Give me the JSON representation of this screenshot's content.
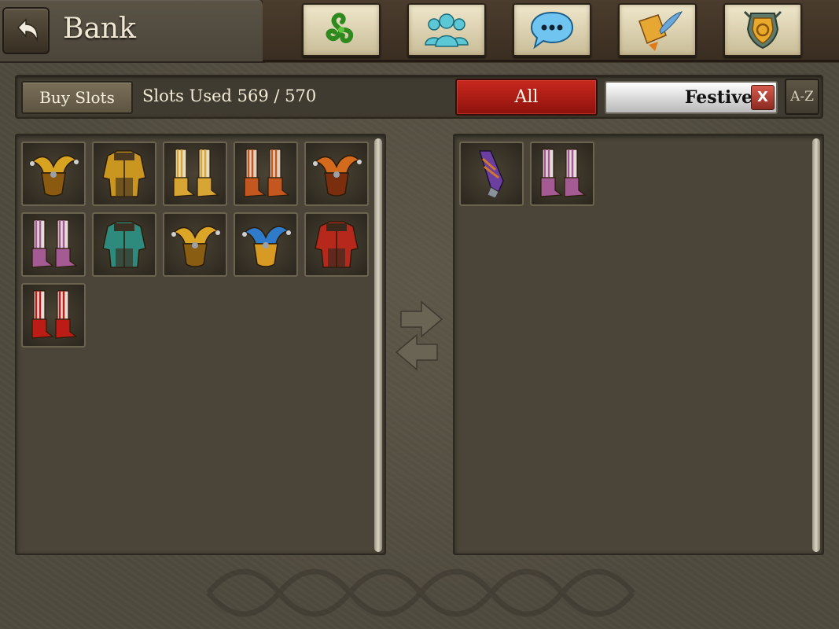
{
  "header": {
    "title": "Bank",
    "back_icon": "back-arrow-icon",
    "nav_tabs": [
      {
        "name": "triskelion-tab",
        "icon": "triskelion-icon"
      },
      {
        "name": "guild-tab",
        "icon": "people-icon"
      },
      {
        "name": "chat-tab",
        "icon": "chat-bubble-icon"
      },
      {
        "name": "quests-tab",
        "icon": "scroll-quill-icon"
      },
      {
        "name": "crest-tab",
        "icon": "shield-crest-icon"
      }
    ]
  },
  "toolbar": {
    "buy_slots_label": "Buy Slots",
    "slots_used_text": "Slots Used 569 / 570",
    "all_label": "All",
    "filter_value": "Festive",
    "clear_label": "X",
    "sort_label": "A-Z"
  },
  "bank_items": [
    {
      "name": "jester-hat-yellow",
      "colors": [
        "#d9a322",
        "#8a5a10"
      ]
    },
    {
      "name": "jester-tunic-yellow",
      "colors": [
        "#c9961f",
        "#4a3820"
      ]
    },
    {
      "name": "jester-boots-yellow",
      "colors": [
        "#d7a534",
        "#e8dcc0"
      ]
    },
    {
      "name": "jester-boots-orange",
      "colors": [
        "#c4561f",
        "#e0d0c0"
      ]
    },
    {
      "name": "jester-hat-orange",
      "colors": [
        "#d46a1c",
        "#7a2e0e"
      ]
    },
    {
      "name": "jester-boots-pink",
      "colors": [
        "#a45a92",
        "#e6dcdc"
      ]
    },
    {
      "name": "jester-tunic-teal",
      "colors": [
        "#2f8a7e",
        "#3a3124"
      ]
    },
    {
      "name": "jester-hat-gold",
      "colors": [
        "#dba528",
        "#8a5e12"
      ]
    },
    {
      "name": "jester-hat-blue",
      "colors": [
        "#2f7ac9",
        "#d79a22"
      ]
    },
    {
      "name": "jester-tunic-red",
      "colors": [
        "#b7281c",
        "#3a2a1e"
      ]
    },
    {
      "name": "jester-boots-red",
      "colors": [
        "#bb1c16",
        "#e8dcd8"
      ]
    }
  ],
  "inventory_items": [
    {
      "name": "purple-bracer",
      "colors": [
        "#6a3fa0",
        "#d07828"
      ]
    },
    {
      "name": "jester-boots-pink",
      "colors": [
        "#a45a92",
        "#e6dcdc"
      ]
    }
  ],
  "colors": {
    "accent_red": "#b8231a",
    "panel": "#4a4538",
    "tab_parchment": "#e6dcc0"
  }
}
